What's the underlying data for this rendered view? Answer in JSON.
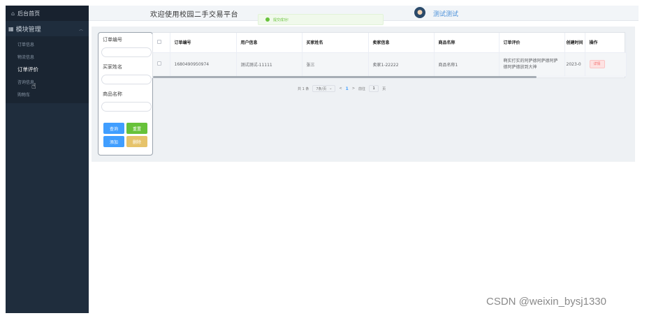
{
  "sidebar": {
    "home_label": "后台首页",
    "group_label": "模块管理",
    "items": [
      {
        "label": "订单信息"
      },
      {
        "label": "物流信息"
      },
      {
        "label": "订单评价"
      },
      {
        "label": "咨询信息"
      },
      {
        "label": "购物车"
      }
    ],
    "active_index": 2
  },
  "header": {
    "title": "欢迎使用校园二手交易平台",
    "username": "测试测试"
  },
  "toast": {
    "message": "提交成功!"
  },
  "filter": {
    "fields": [
      {
        "label": "订单编号",
        "value": ""
      },
      {
        "label": "买家姓名",
        "value": ""
      },
      {
        "label": "商品名称",
        "value": ""
      }
    ],
    "buttons": {
      "search": "查询",
      "reset": "重置",
      "add": "添加",
      "delete": "删除"
    }
  },
  "table": {
    "columns": [
      "订单编号",
      "用户信息",
      "买家姓名",
      "卖家信息",
      "商品名称",
      "订单评价",
      "创建时间",
      "操作"
    ],
    "rows": [
      {
        "order_no": "1680490950974",
        "user_info": "测试测试-11111",
        "buyer_name": "张三",
        "seller_info": "卖家1-22222",
        "product_name": "商品名称1",
        "review": "啊实打实的阿萨德阿萨德阿萨德阿萨德放到大神",
        "created": "2023-0",
        "action": "详情"
      }
    ]
  },
  "pager": {
    "total": "共 1 条",
    "page_size": "7条/页",
    "prev": "<",
    "current": "1",
    "next": ">",
    "goto_label": "前往",
    "goto_value": "1",
    "page_suffix": "页"
  },
  "watermark": "CSDN @weixin_bysj1330",
  "colors": {
    "sidebar_bg": "#1f2d3d",
    "primary": "#409eff",
    "success": "#67c23a",
    "warning": "#e6c36a",
    "danger": "#f56c6c"
  }
}
